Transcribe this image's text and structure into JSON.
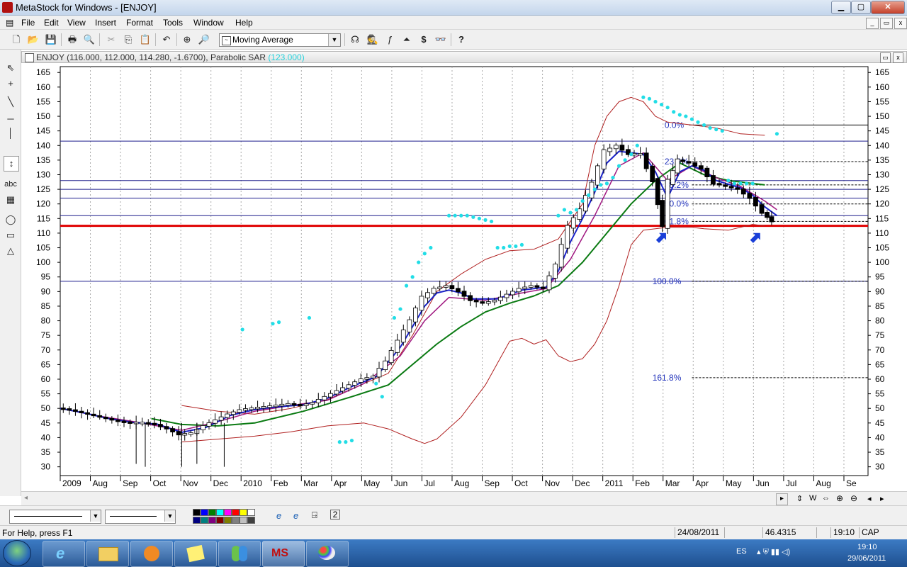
{
  "window": {
    "title": "MetaStock for Windows - [ENJOY]",
    "app_icon": "metastock-icon",
    "btn_min": "▁",
    "btn_max": "▢",
    "btn_close": "✕",
    "mdi_min": "_",
    "mdi_restore": "▭",
    "mdi_close": "x"
  },
  "menu": {
    "items": [
      "File",
      "Edit",
      "View",
      "Insert",
      "Format",
      "Tools",
      "Window",
      "Help"
    ],
    "doc_icon": "▤"
  },
  "toolbar": {
    "indicator_select": "Moving Average",
    "icons": [
      "new-icon",
      "open-icon",
      "save-icon",
      "print-icon",
      "print-preview-icon",
      "cut-icon",
      "copy-icon",
      "paste-icon",
      "undo-icon",
      "crosshair-icon",
      "zoom-icon"
    ],
    "icons_right": [
      "expert-advisor-icon",
      "explorer-icon",
      "indicator-builder-icon",
      "system-tester-icon",
      "dollar-icon",
      "binoculars-icon",
      "help-pointer-icon"
    ],
    "glyphs": [
      "🗋",
      "📂",
      "💾",
      "🖶",
      "🔍",
      "✂",
      "⎘",
      "📋",
      "↶",
      "⊕",
      "🔎"
    ],
    "glyphs_right": [
      "☊",
      "🕵",
      "ƒ",
      "⏶",
      "$",
      "👓",
      "?"
    ]
  },
  "chart_header": {
    "text": "ENJOY (116.000, 112.000, 114.280, -1.6700), Parabolic SAR",
    "sar_value": "(123.000)",
    "icons": [
      "▭",
      "x"
    ]
  },
  "left_tools": [
    "⇖",
    "+",
    "╲",
    "─",
    "│",
    "↕",
    "abc",
    "▦",
    "◯",
    "▭",
    "△"
  ],
  "chart_data": {
    "type": "line",
    "title": "ENJOY (116.000, 112.000, 114.280, -1.6700), Parabolic SAR",
    "y_range": [
      27,
      167
    ],
    "y_ticks": [
      30,
      35,
      40,
      45,
      50,
      55,
      60,
      65,
      70,
      75,
      80,
      85,
      90,
      95,
      100,
      105,
      110,
      115,
      120,
      125,
      130,
      135,
      140,
      145,
      150,
      155,
      160,
      165
    ],
    "x_labels": [
      "2009",
      "Aug",
      "Sep",
      "Oct",
      "Nov",
      "Dec",
      "2010",
      "Feb",
      "Mar",
      "Apr",
      "May",
      "Jun",
      "Jul",
      "Aug",
      "Sep",
      "Oct",
      "Nov",
      "Dec",
      "2011",
      "Feb",
      "Mar",
      "Apr",
      "May",
      "Jun",
      "Jul",
      "Aug",
      "Se"
    ],
    "price": [
      [
        0,
        50
      ],
      [
        2,
        49.5
      ],
      [
        4,
        48.5
      ],
      [
        6,
        47.5
      ],
      [
        8,
        46.5
      ],
      [
        10,
        45.5
      ],
      [
        12,
        45
      ],
      [
        14,
        45
      ],
      [
        16,
        44.5
      ],
      [
        18,
        43
      ],
      [
        20,
        41
      ],
      [
        22,
        41.5
      ],
      [
        24,
        44
      ],
      [
        26,
        46
      ],
      [
        28,
        48
      ],
      [
        30,
        49.5
      ],
      [
        32,
        50
      ],
      [
        34,
        50.5
      ],
      [
        36,
        51
      ],
      [
        38,
        51.5
      ],
      [
        40,
        51
      ],
      [
        42,
        52
      ],
      [
        44,
        54
      ],
      [
        46,
        56
      ],
      [
        48,
        58
      ],
      [
        50,
        60
      ],
      [
        52,
        61
      ],
      [
        54,
        66
      ],
      [
        56,
        73
      ],
      [
        58,
        80
      ],
      [
        60,
        88
      ],
      [
        62,
        91
      ],
      [
        64,
        92
      ],
      [
        66,
        90
      ],
      [
        68,
        87
      ],
      [
        70,
        86
      ],
      [
        72,
        87
      ],
      [
        74,
        89
      ],
      [
        76,
        91
      ],
      [
        78,
        92
      ],
      [
        80,
        91
      ],
      [
        82,
        99
      ],
      [
        84,
        112
      ],
      [
        86,
        118
      ],
      [
        88,
        127
      ],
      [
        90,
        138
      ],
      [
        92,
        140
      ],
      [
        94,
        137
      ],
      [
        96,
        137
      ],
      [
        98,
        128
      ],
      [
        99.5,
        113
      ],
      [
        100.5,
        127
      ],
      [
        102,
        135
      ],
      [
        104,
        134
      ],
      [
        106,
        132
      ],
      [
        108,
        127
      ],
      [
        110,
        126
      ],
      [
        112,
        125
      ],
      [
        114,
        122
      ],
      [
        116,
        117
      ],
      [
        117.5,
        114
      ]
    ],
    "ma_fast": [
      [
        0,
        50
      ],
      [
        4,
        48.4
      ],
      [
        8,
        46.5
      ],
      [
        12,
        45.2
      ],
      [
        16,
        44.6
      ],
      [
        20,
        41.8
      ],
      [
        24,
        43.5
      ],
      [
        28,
        47.6
      ],
      [
        32,
        49.6
      ],
      [
        36,
        50.6
      ],
      [
        40,
        51.2
      ],
      [
        44,
        53.5
      ],
      [
        48,
        57.5
      ],
      [
        52,
        60.8
      ],
      [
        56,
        71
      ],
      [
        60,
        85
      ],
      [
        62,
        89.5
      ],
      [
        64,
        90.5
      ],
      [
        66,
        89.5
      ],
      [
        68,
        87.5
      ],
      [
        72,
        87.5
      ],
      [
        76,
        90.5
      ],
      [
        80,
        91.5
      ],
      [
        82,
        97
      ],
      [
        84,
        107
      ],
      [
        86,
        115
      ],
      [
        88,
        124
      ],
      [
        90,
        134
      ],
      [
        92,
        138
      ],
      [
        96,
        137
      ],
      [
        98,
        131
      ],
      [
        100,
        122
      ],
      [
        102,
        131
      ],
      [
        104,
        133
      ],
      [
        106,
        131.5
      ],
      [
        108,
        128
      ],
      [
        112,
        125.5
      ],
      [
        114,
        123
      ],
      [
        116,
        119
      ],
      [
        118,
        116
      ]
    ],
    "ma_mid": [
      [
        0,
        50
      ],
      [
        6,
        47.5
      ],
      [
        12,
        45.5
      ],
      [
        20,
        42.5
      ],
      [
        26,
        45.5
      ],
      [
        32,
        49
      ],
      [
        38,
        51
      ],
      [
        44,
        52.8
      ],
      [
        50,
        58.5
      ],
      [
        56,
        68
      ],
      [
        60,
        80
      ],
      [
        64,
        88
      ],
      [
        70,
        87
      ],
      [
        76,
        89.5
      ],
      [
        80,
        91
      ],
      [
        84,
        101
      ],
      [
        88,
        116
      ],
      [
        92,
        133
      ],
      [
        96,
        137.5
      ],
      [
        100,
        128
      ],
      [
        104,
        133
      ],
      [
        108,
        129
      ],
      [
        112,
        126
      ],
      [
        116,
        121
      ],
      [
        118,
        118
      ]
    ],
    "ma_long": [
      [
        15,
        46.5
      ],
      [
        20,
        44.5
      ],
      [
        26,
        44
      ],
      [
        32,
        45
      ],
      [
        40,
        49
      ],
      [
        48,
        54
      ],
      [
        54,
        58
      ],
      [
        58,
        65
      ],
      [
        62,
        72
      ],
      [
        66,
        78
      ],
      [
        70,
        83
      ],
      [
        74,
        86
      ],
      [
        78,
        88.5
      ],
      [
        82,
        92
      ],
      [
        86,
        100
      ],
      [
        90,
        110
      ],
      [
        94,
        120
      ],
      [
        98,
        128
      ],
      [
        102,
        134
      ],
      [
        106,
        130
      ],
      [
        110,
        128
      ],
      [
        114,
        127
      ],
      [
        116,
        126.5
      ]
    ],
    "bb_upper": [
      [
        20,
        51
      ],
      [
        26,
        49
      ],
      [
        32,
        48
      ],
      [
        38,
        50
      ],
      [
        44,
        53
      ],
      [
        50,
        58.5
      ],
      [
        54,
        62
      ],
      [
        58,
        75
      ],
      [
        62,
        90
      ],
      [
        66,
        96
      ],
      [
        70,
        101
      ],
      [
        74,
        104
      ],
      [
        78,
        104.5
      ],
      [
        82,
        108
      ],
      [
        86,
        120
      ],
      [
        88,
        140
      ],
      [
        90,
        150
      ],
      [
        92,
        155
      ],
      [
        94,
        156.5
      ],
      [
        96,
        155
      ],
      [
        98,
        150
      ],
      [
        100,
        148
      ],
      [
        104,
        147
      ],
      [
        108,
        146
      ],
      [
        112,
        144
      ],
      [
        116,
        143.5
      ]
    ],
    "bb_lower": [
      [
        20,
        38.5
      ],
      [
        26,
        39.5
      ],
      [
        32,
        40.5
      ],
      [
        38,
        42
      ],
      [
        44,
        44
      ],
      [
        50,
        45
      ],
      [
        54,
        43
      ],
      [
        58,
        39.5
      ],
      [
        60,
        38
      ],
      [
        62,
        39.5
      ],
      [
        66,
        47
      ],
      [
        70,
        58
      ],
      [
        74,
        73
      ],
      [
        76,
        74
      ],
      [
        78,
        72
      ],
      [
        80,
        73.5
      ],
      [
        82,
        68
      ],
      [
        84,
        66
      ],
      [
        86,
        67
      ],
      [
        88,
        72
      ],
      [
        90,
        80
      ],
      [
        92,
        92
      ],
      [
        94,
        106
      ],
      [
        96,
        111
      ],
      [
        100,
        112
      ],
      [
        104,
        112
      ],
      [
        106,
        111.5
      ],
      [
        110,
        111
      ],
      [
        114,
        113
      ],
      [
        116,
        112.5
      ]
    ],
    "sar_dots": [
      [
        30,
        77
      ],
      [
        35,
        79
      ],
      [
        36,
        79.5
      ],
      [
        41,
        81
      ],
      [
        46,
        38.5
      ],
      [
        47,
        38.5
      ],
      [
        48,
        39
      ],
      [
        52,
        58.5
      ],
      [
        53,
        54
      ],
      [
        55,
        81
      ],
      [
        56,
        84
      ],
      [
        57,
        92
      ],
      [
        58,
        95
      ],
      [
        59,
        100
      ],
      [
        60,
        103
      ],
      [
        61,
        105
      ],
      [
        64,
        116
      ],
      [
        65,
        116
      ],
      [
        66,
        116
      ],
      [
        67,
        116
      ],
      [
        68,
        115.5
      ],
      [
        69,
        115
      ],
      [
        70,
        114.5
      ],
      [
        71,
        114
      ],
      [
        72,
        105
      ],
      [
        73,
        105
      ],
      [
        74,
        105.5
      ],
      [
        75,
        105.5
      ],
      [
        76,
        106
      ],
      [
        82,
        116
      ],
      [
        83,
        118
      ],
      [
        84,
        117
      ],
      [
        85,
        118
      ],
      [
        86,
        121
      ],
      [
        87,
        123
      ],
      [
        88,
        125
      ],
      [
        89,
        126.5
      ],
      [
        90,
        127
      ],
      [
        91,
        129
      ],
      [
        92,
        133
      ],
      [
        93,
        135
      ],
      [
        94,
        137
      ],
      [
        95,
        140
      ],
      [
        96,
        156.5
      ],
      [
        97,
        156
      ],
      [
        98,
        155
      ],
      [
        99,
        154
      ],
      [
        100,
        153
      ],
      [
        101,
        151.5
      ],
      [
        102,
        150.5
      ],
      [
        103,
        150
      ],
      [
        104,
        149
      ],
      [
        105,
        148
      ],
      [
        106,
        147
      ],
      [
        107,
        146
      ],
      [
        108,
        145.5
      ],
      [
        109,
        145
      ],
      [
        110,
        128
      ],
      [
        111,
        127
      ],
      [
        112,
        127
      ],
      [
        113,
        127
      ],
      [
        114,
        127
      ],
      [
        118,
        144
      ]
    ],
    "fib_levels": [
      {
        "label": "0.0%",
        "value": 147
      },
      {
        "label": "23.6%",
        "value": 134.5
      },
      {
        "label": "38.2%",
        "value": 126.5
      },
      {
        "label": "50.0%",
        "value": 120
      },
      {
        "label": "61.8%",
        "value": 114
      },
      {
        "label": "100.0%",
        "value": 93.5
      },
      {
        "label": "161.8%",
        "value": 60.5
      }
    ],
    "hlines": [
      141.5,
      128,
      125,
      122,
      116,
      93.5
    ],
    "support_line": 112.5
  },
  "hscroll": {
    "icons": [
      "◂",
      "▸"
    ],
    "right_controls": [
      "⇕",
      "W",
      "⇔",
      "⊕",
      "⊖",
      "◂",
      "▸"
    ]
  },
  "bottom": {
    "swatches": [
      "#000000",
      "#0000ff",
      "#008000",
      "#00ffff",
      "#ff00ff",
      "#ff0000",
      "#ffff00",
      "#ffffff",
      "#000080",
      "#008080",
      "#800080",
      "#800000",
      "#808000",
      "#808080",
      "#c0c0c0",
      "#404040"
    ],
    "icons": [
      "e",
      "e",
      "⍈",
      "2"
    ]
  },
  "status": {
    "help": "For Help, press F1",
    "date": "24/08/2011",
    "value": "46.4315",
    "time": "19:10",
    "caps": "CAP"
  },
  "taskbar": {
    "lang": "ES",
    "clock_time": "19:10",
    "clock_date": "29/06/2011",
    "tasks": [
      "ie-icon",
      "folder-icon",
      "media-icon",
      "notes-icon",
      "messenger-icon",
      "metastock-icon",
      "paint-icon"
    ],
    "ms_label": "MS",
    "tray_icons": "▴ ⛨ ▮▮ ◁)"
  }
}
